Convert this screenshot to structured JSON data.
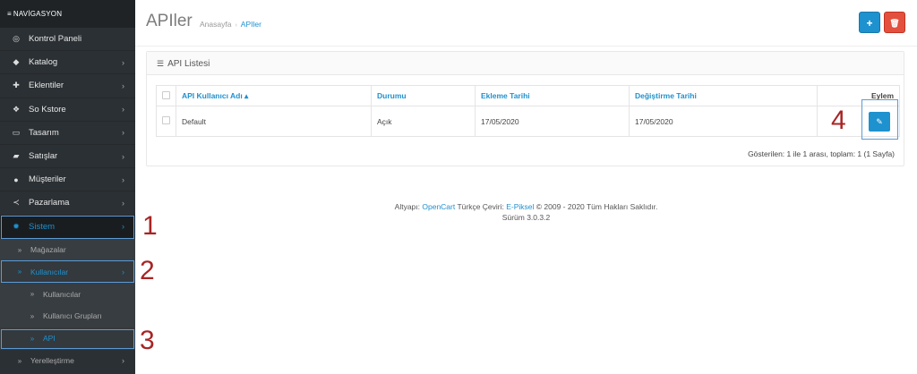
{
  "sidebar": {
    "header": "NAVİGASYON",
    "items": [
      {
        "label": "Kontrol Paneli",
        "icon": "dashboard-icon",
        "glyph": "◎",
        "chevron": ""
      },
      {
        "label": "Katalog",
        "icon": "tag-icon",
        "glyph": "◆",
        "chevron": "›"
      },
      {
        "label": "Eklentiler",
        "icon": "puzzle-icon",
        "glyph": "✚",
        "chevron": "›"
      },
      {
        "label": "So Kstore",
        "icon": "cubes-icon",
        "glyph": "❖",
        "chevron": "›"
      },
      {
        "label": "Tasarım",
        "icon": "desktop-icon",
        "glyph": "▭",
        "chevron": "›"
      },
      {
        "label": "Satışlar",
        "icon": "cart-icon",
        "glyph": "▰",
        "chevron": "›"
      },
      {
        "label": "Müşteriler",
        "icon": "user-icon",
        "glyph": "●",
        "chevron": "›"
      },
      {
        "label": "Pazarlama",
        "icon": "share-icon",
        "glyph": "≺",
        "chevron": "›"
      },
      {
        "label": "Sistem",
        "icon": "gear-icon",
        "glyph": "✹",
        "chevron": "›"
      }
    ],
    "system_sub": [
      {
        "label": "Mağazalar"
      },
      {
        "label": "Kullanıcılar",
        "chevron": "›"
      }
    ],
    "users_sub": [
      {
        "label": "Kullanıcılar"
      },
      {
        "label": "Kullanıcı Grupları"
      },
      {
        "label": "API"
      }
    ],
    "localization": {
      "label": "Yerelleştirme",
      "chevron": "›"
    }
  },
  "annotations": [
    "1",
    "2",
    "3",
    "4"
  ],
  "header": {
    "title": "APIler",
    "breadcrumb_home": "Anasayfa",
    "breadcrumb_sep": "›",
    "breadcrumb_current": "APIler",
    "add_glyph": "+",
    "delete_glyph": "🗑"
  },
  "panel": {
    "title": "API Listesi",
    "columns": {
      "username": "API Kullanıcı Adı ▴",
      "status": "Durumu",
      "date_added": "Ekleme Tarihi",
      "date_modified": "Değiştirme Tarihi",
      "action": "Eylem"
    },
    "rows": [
      {
        "username": "Default",
        "status": "Açık",
        "date_added": "17/05/2020",
        "date_modified": "17/05/2020",
        "edit_glyph": "✎"
      }
    ],
    "pagination": "Gösterilen: 1 ile 1 arası, toplam: 1 (1 Sayfa)"
  },
  "footer": {
    "prefix": "Altyapı: ",
    "opencart": "OpenCart",
    "mid": " Türkçe Çeviri: ",
    "epiksel": "E-Piksel",
    "suffix": " © 2009 - 2020 Tüm Hakları Saklıdır.",
    "version": "Sürüm 3.0.3.2"
  },
  "colors": {
    "accent": "#1e91cf",
    "sidebar_bg": "#2b3034",
    "danger": "#e3503e",
    "annotation_red": "#a82424",
    "highlight_blue": "#5b9bd5"
  }
}
